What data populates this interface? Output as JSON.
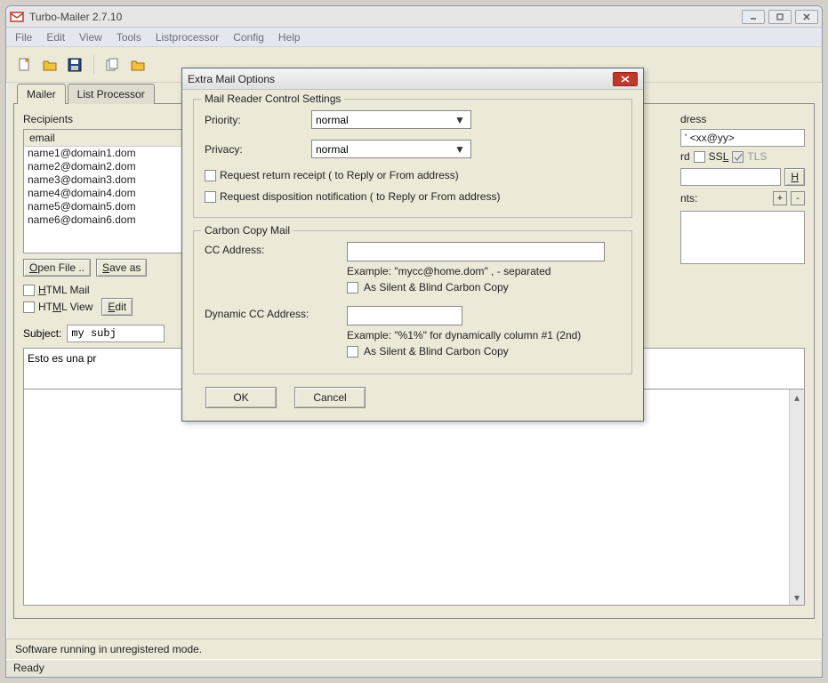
{
  "window": {
    "title": "Turbo-Mailer 2.7.10",
    "menus": [
      "File",
      "Edit",
      "View",
      "Tools",
      "Listprocessor",
      "Config",
      "Help"
    ]
  },
  "tabs": {
    "mailer": "Mailer",
    "listproc": "List Processor"
  },
  "recipients": {
    "label": "Recipients",
    "column": "email",
    "rows": [
      "name1@domain1.dom",
      "name2@domain2.dom",
      "name3@domain3.dom",
      "name4@domain4.dom",
      "name5@domain5.dom",
      "name6@domain6.dom"
    ],
    "open_file": "Open File ..",
    "save_as": "Save as"
  },
  "options": {
    "html_mail": "HTML Mail",
    "html_view": "HTML View",
    "edit_btn": "Edit"
  },
  "subject": {
    "label": "Subject:",
    "value": "my subj"
  },
  "body": {
    "text": "Esto es una pr"
  },
  "right": {
    "address_label": "dress",
    "address_hint": "' <xx@yy>",
    "rd": "rd",
    "ssl": "SSL",
    "tls": "TLS",
    "h_btn": "H",
    "nts": "nts:"
  },
  "footer": {
    "unregistered": "Software running in unregistered mode.",
    "status": "Ready"
  },
  "dialog": {
    "title": "Extra Mail Options",
    "group1": {
      "legend": "Mail Reader Control Settings",
      "priority_label": "Priority:",
      "priority_value": "normal",
      "privacy_label": "Privacy:",
      "privacy_value": "normal",
      "receipt": "Request return receipt   ( to Reply or From address)",
      "disposition": "Request disposition notification   ( to Reply or From address)"
    },
    "group2": {
      "legend": "Carbon Copy Mail",
      "cc_label": "CC Address:",
      "cc_example": "Example: \"mycc@home.dom\"     , - separated",
      "cc_blind": "As Silent & Blind Carbon Copy",
      "dyn_label": "Dynamic CC Address:",
      "dyn_example": "Example: \"%1%\" for dynamically column #1 (2nd)",
      "dyn_blind": "As Silent & Blind Carbon Copy"
    },
    "buttons": {
      "ok": "OK",
      "cancel": "Cancel"
    }
  }
}
